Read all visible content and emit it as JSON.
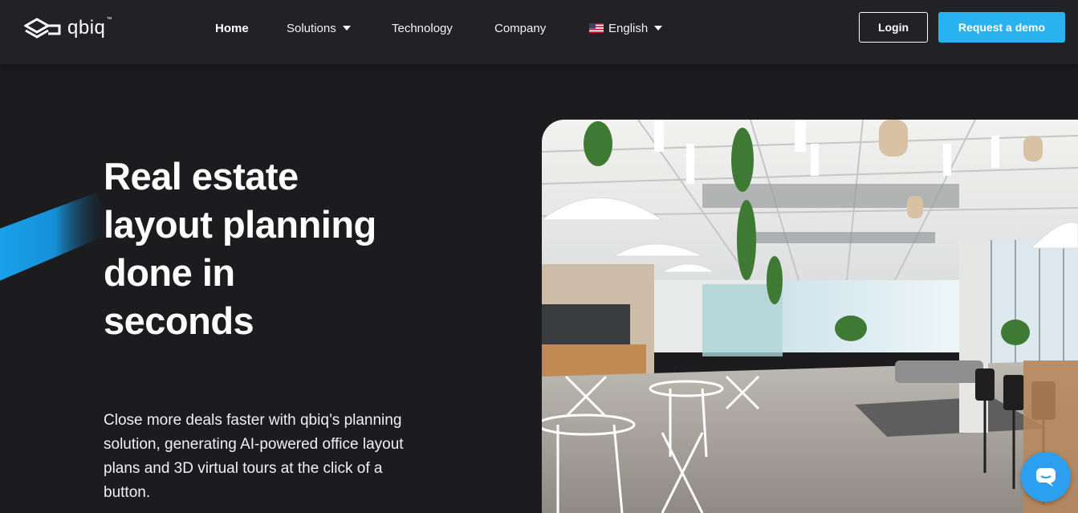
{
  "brand": {
    "name": "qbiq",
    "tm": "™"
  },
  "nav": {
    "items": [
      {
        "label": "Home",
        "active": true,
        "dropdown": false
      },
      {
        "label": "Solutions",
        "active": false,
        "dropdown": true
      },
      {
        "label": "Technology",
        "active": false,
        "dropdown": false
      },
      {
        "label": "Company",
        "active": false,
        "dropdown": false
      },
      {
        "label": "English",
        "active": false,
        "dropdown": true,
        "icon": "us-flag-icon"
      }
    ]
  },
  "actions": {
    "login_label": "Login",
    "demo_label": "Request a demo"
  },
  "hero": {
    "headline": "Real estate layout planning done in seconds",
    "subtext": "Close more deals faster with qbiq’s planning solution, generating AI-powered office layout plans and 3D virtual tours at the click of a button."
  },
  "colors": {
    "accent": "#29b2f0",
    "background": "#1c1c1f",
    "navbar": "#222226",
    "chat": "#2c9ff0"
  },
  "icons": {
    "chat": "chat-icon",
    "logo": "qbiq-logo-icon"
  }
}
